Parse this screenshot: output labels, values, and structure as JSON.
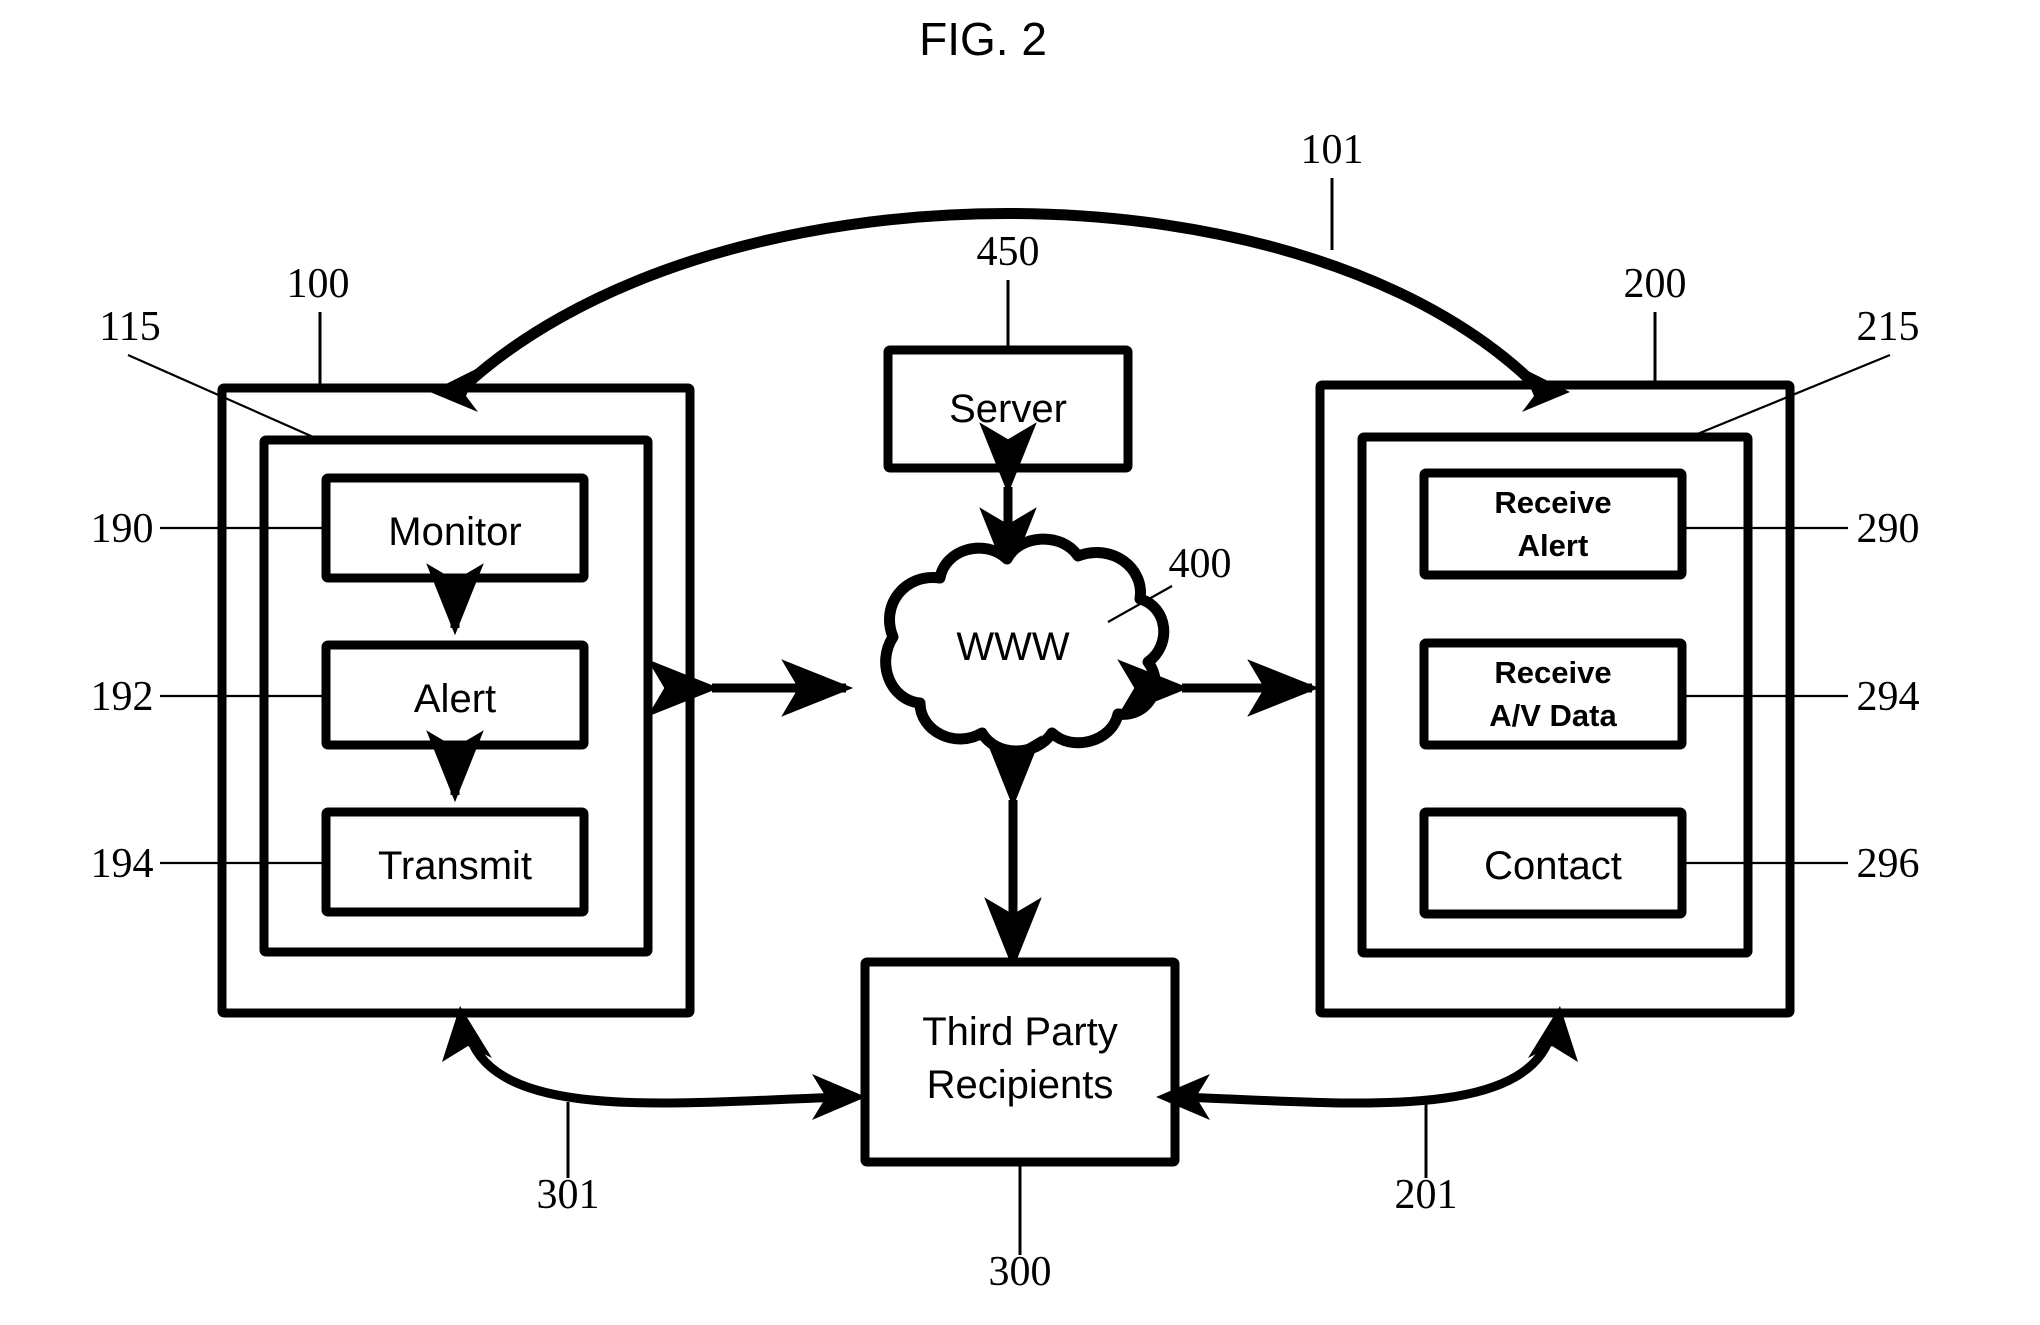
{
  "figure": {
    "title": "FIG. 2",
    "type": "patent-block-diagram"
  },
  "nodes": {
    "left_device": {
      "outer_ref": "115",
      "inner_ref": "100",
      "blocks": [
        {
          "label": "Monitor",
          "ref": "190"
        },
        {
          "label": "Alert",
          "ref": "192"
        },
        {
          "label": "Transmit",
          "ref": "194"
        }
      ]
    },
    "right_device": {
      "outer_ref": "200",
      "inner_ref": "215",
      "blocks": [
        {
          "label_line1": "Receive",
          "label_line2": "Alert",
          "ref": "290"
        },
        {
          "label_line1": "Receive",
          "label_line2": "A/V Data",
          "ref": "294"
        },
        {
          "label_line1": "Contact",
          "label_line2": "",
          "ref": "296"
        }
      ]
    },
    "server": {
      "label": "Server",
      "ref": "450"
    },
    "network": {
      "label": "WWW",
      "ref": "400"
    },
    "third_party": {
      "label_line1": "Third Party",
      "label_line2": "Recipients",
      "ref": "300"
    }
  },
  "connectors": {
    "top_arc": {
      "ref": "101"
    },
    "left_bottom_arc": {
      "ref": "301"
    },
    "right_bottom_arc": {
      "ref": "201"
    }
  },
  "colors": {
    "stroke": "#000000",
    "background": "#ffffff"
  }
}
